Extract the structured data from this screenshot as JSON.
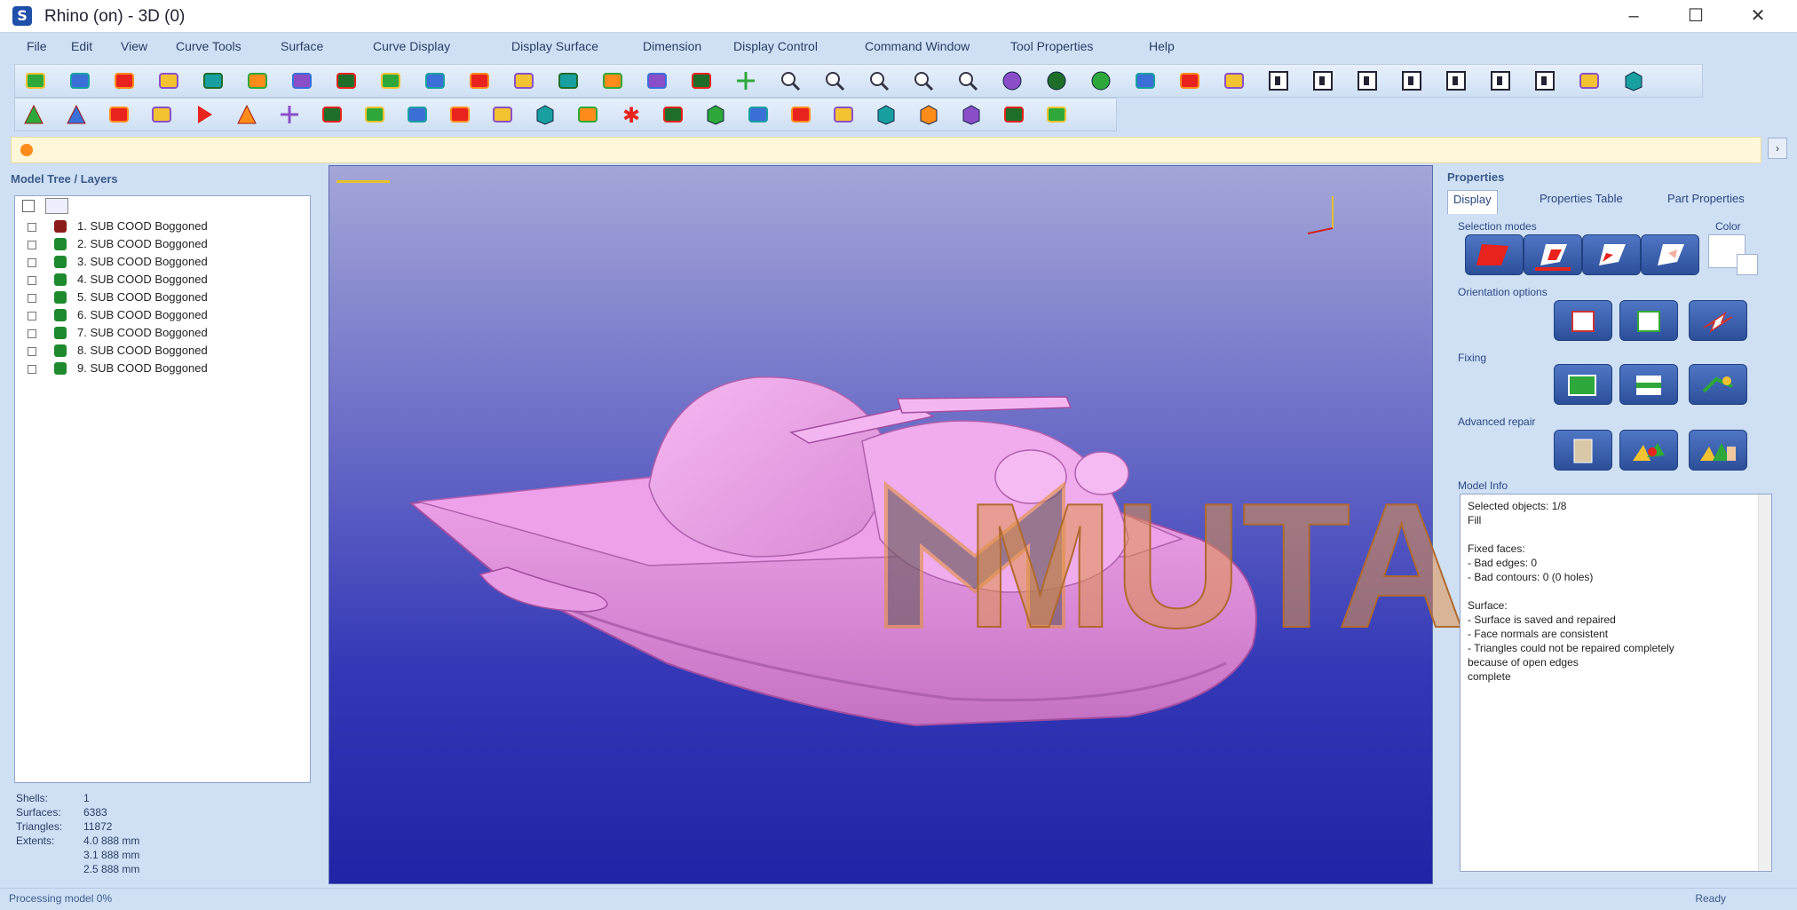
{
  "window": {
    "title": "Rhino (on) - 3D (0)",
    "minimize_glyph": "–",
    "maximize_glyph": "☐",
    "close_glyph": "✕"
  },
  "menu": [
    "File",
    "Edit",
    "View",
    "Curve Tools",
    "Surface",
    "Curve Display",
    "Display Surface",
    "Dimension",
    "Display Control",
    "Command Window",
    "Tool Properties",
    "Help"
  ],
  "toolbar_icons": {
    "row1": [
      "new-file-icon",
      "save-icon",
      "open-icon",
      "save-as-icon",
      "print-icon",
      "copy-icon",
      "paste-icon",
      "settings-icon",
      "undo-icon",
      "redo-icon",
      "grid-icon",
      "edit-surface-icon",
      "surface-icon",
      "surface-blue-icon",
      "surface-green-icon",
      "arc-icon",
      "plus-icon",
      "zoom-window-icon",
      "zoom-extents-icon",
      "zoom-in-icon",
      "zoom-out-icon",
      "zoom-selected-icon",
      "shade-icon",
      "render-icon",
      "render-green-icon",
      "material-icon",
      "texture-icon",
      "layer-icon",
      "view-top-icon",
      "view-front-icon",
      "view-right-icon",
      "view-left-icon",
      "view-back-icon",
      "view-bottom-icon",
      "view-persp-icon",
      "object-icon",
      "toolbox-icon"
    ],
    "row2": [
      "triangle-icon",
      "triangle-half-icon",
      "sector-icon",
      "sector-dot-icon",
      "play-icon",
      "blue-triangle-icon",
      "crosshair-icon",
      "h-bar-icon",
      "rounded-rect-icon",
      "cylinder-icon",
      "twist-icon",
      "leaf-icon",
      "cube-green-icon",
      "lasso-icon",
      "star-icon",
      "select-corner-icon",
      "select-box-icon",
      "select-cut-icon",
      "select-y-icon",
      "document-icon",
      "box-icon",
      "cube-icon",
      "cube-mesh-icon",
      "pipe-icon",
      "lock-icon"
    ]
  },
  "left_panel": {
    "title": "Model Tree / Layers",
    "tree_items": [
      {
        "label": "1. SUB COOD Boggoned",
        "color": "#8b1a1a"
      },
      {
        "label": "2. SUB COOD Boggoned",
        "color": "#1e8a2e"
      },
      {
        "label": "3. SUB COOD Boggoned",
        "color": "#1e8a2e"
      },
      {
        "label": "4. SUB COOD Boggoned",
        "color": "#1e8a2e"
      },
      {
        "label": "5. SUB COOD Boggoned",
        "color": "#1e8a2e"
      },
      {
        "label": "6. SUB COOD Boggoned",
        "color": "#1e8a2e"
      },
      {
        "label": "7. SUB COOD Boggoned",
        "color": "#1e8a2e"
      },
      {
        "label": "8. SUB COOD Boggoned",
        "color": "#1e8a2e"
      },
      {
        "label": "9. SUB COOD Boggoned",
        "color": "#1e8a2e"
      }
    ],
    "info": [
      {
        "key": "Shells:",
        "value": "1"
      },
      {
        "key": "Surfaces:",
        "value": "6383"
      },
      {
        "key": "Triangles:",
        "value": "11872"
      },
      {
        "key": "Extents:",
        "value": "4.0 888 mm"
      },
      {
        "key": "",
        "value": "3.1 888 mm"
      },
      {
        "key": "",
        "value": "2.5 888 mm"
      }
    ]
  },
  "right_panel": {
    "title": "Properties",
    "tabs": [
      "Display",
      "Properties Table",
      "Part Properties"
    ],
    "groups": {
      "display_mode": "Selection modes",
      "color": "Color",
      "orientation": "Orientation options",
      "fixing": "Fixing",
      "advanced": "Advanced repair",
      "log": "Model Info"
    },
    "log_lines": [
      "Selected objects: 1/8",
      "Fill",
      "",
      "Fixed faces:",
      "  - Bad edges: 0",
      "  - Bad contours: 0 (0 holes)",
      "",
      "Surface:",
      "  - Surface is saved and repaired",
      "  - Face normals are consistent",
      "  - Triangles could not be repaired completely",
      "    because of open edges",
      "  complete"
    ]
  },
  "status": {
    "left": "Processing model 0%",
    "right": "Ready"
  },
  "watermark_text": "MUTAZ",
  "colors": {
    "model": "#e88fe2",
    "accent": "#1f4fa8",
    "viewport_top": "#a4a6d8",
    "viewport_bottom": "#1f24a6",
    "watermark": "#e0914a"
  }
}
